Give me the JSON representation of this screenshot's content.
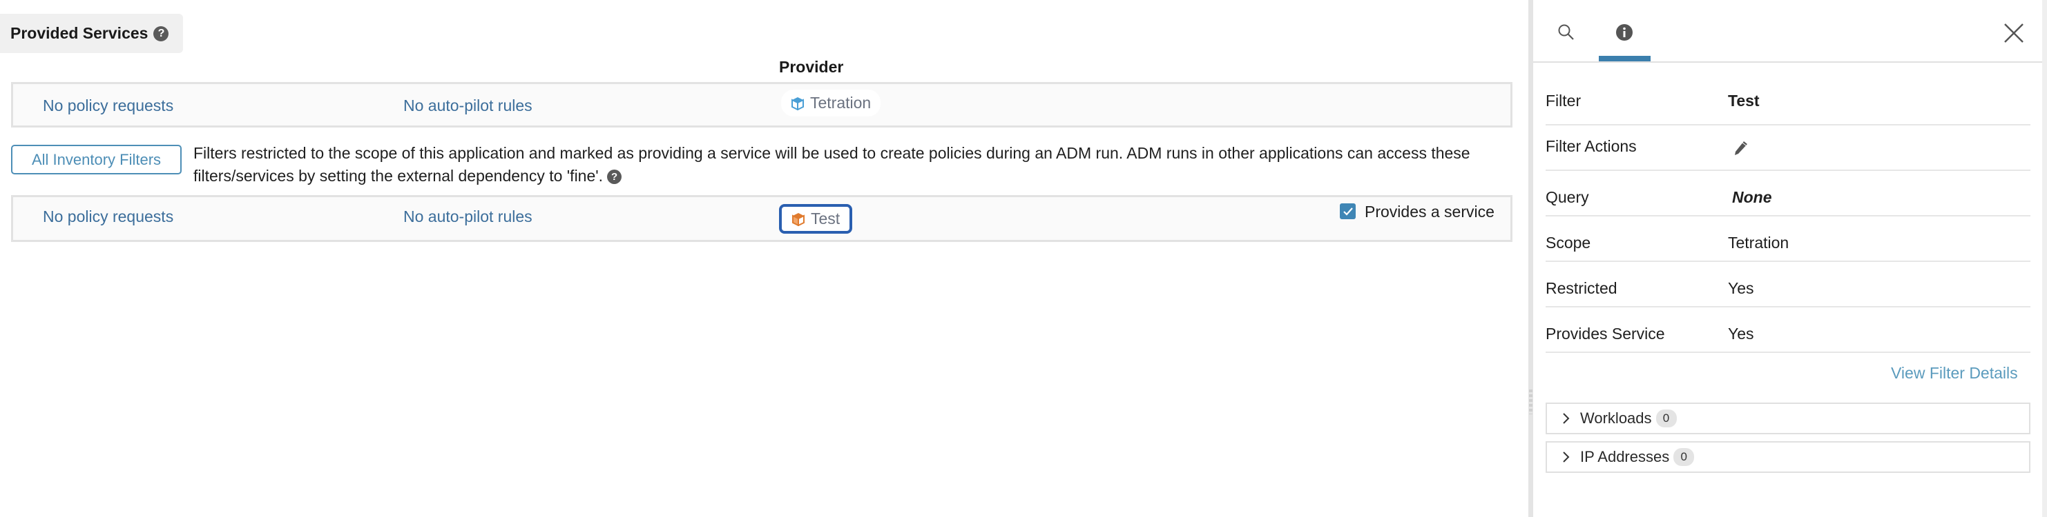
{
  "section": {
    "title": "Provided Services",
    "help_icon": "question-circle-icon"
  },
  "provider_column": {
    "heading": "Provider"
  },
  "rows": [
    {
      "policy_requests": "No policy requests",
      "autopilot_rules": "No auto-pilot rules",
      "provider": "Tetration",
      "provider_icon": "cube-icon",
      "provider_icon_color": "#4a9fd6",
      "selected": false
    },
    {
      "policy_requests": "No policy requests",
      "autopilot_rules": "No auto-pilot rules",
      "provider": "Test",
      "provider_icon": "cube-icon",
      "provider_icon_color": "#e07b2e",
      "selected": true,
      "provides_service_label": "Provides a service",
      "provides_service_checked": true
    }
  ],
  "inventory_filters": {
    "button_label": "All Inventory Filters",
    "description": "Filters restricted to the scope of this application and marked as providing a service will be used to create policies during an ADM run. ADM runs in other applications can access these filters/services by setting the external dependency to 'fine'."
  },
  "side_panel": {
    "tabs": [
      {
        "name": "search",
        "icon": "search-icon",
        "active": false
      },
      {
        "name": "info",
        "icon": "info-icon",
        "active": true
      }
    ],
    "close_icon": "close-icon",
    "properties": [
      {
        "label": "Filter",
        "value": "Test",
        "style": "bold"
      },
      {
        "label": "Filter Actions",
        "value": "",
        "icon": "pencil-icon"
      },
      {
        "label": "Query",
        "value": "None",
        "style": "bold-italic"
      },
      {
        "label": "Scope",
        "value": "Tetration"
      },
      {
        "label": "Restricted",
        "value": "Yes"
      },
      {
        "label": "Provides Service",
        "value": "Yes"
      }
    ],
    "view_details_link": "View Filter Details",
    "accordions": [
      {
        "label": "Workloads",
        "count": "0"
      },
      {
        "label": "IP Addresses",
        "count": "0"
      }
    ]
  },
  "colors": {
    "link": "#3c6e9b",
    "accent": "#3b7fad",
    "selected_border": "#2a5fb0"
  }
}
